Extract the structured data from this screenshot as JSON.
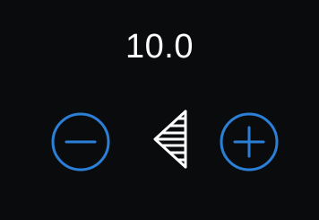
{
  "display": {
    "value": "10.0"
  },
  "controls": {
    "decrease_icon": "minus-circle-icon",
    "increase_icon": "plus-circle-icon",
    "indicator_icon": "speaker-volume-icon"
  },
  "colors": {
    "background": "#0a0b0d",
    "accent": "#2b7fd6",
    "text": "#ffffff"
  }
}
